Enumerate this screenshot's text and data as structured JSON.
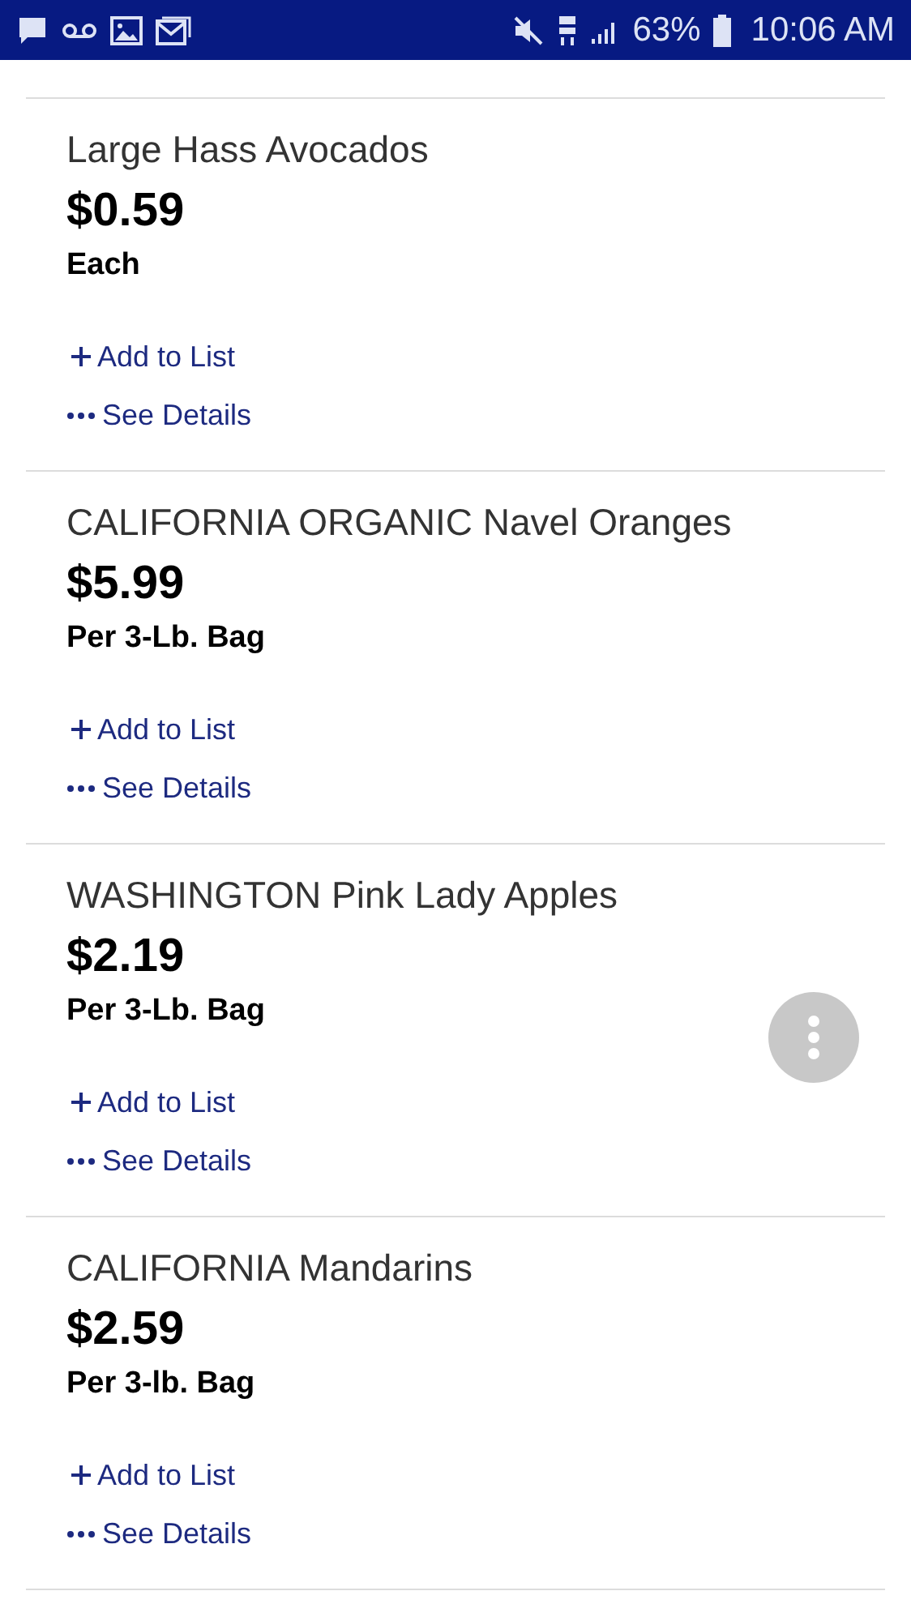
{
  "status_bar": {
    "battery": "63%",
    "time": "10:06 AM"
  },
  "products": [
    {
      "name": "Large Hass Avocados",
      "price": "$0.59",
      "unit": "Each",
      "add": "Add to List",
      "details": "See Details"
    },
    {
      "name": "CALIFORNIA ORGANIC Navel Oranges",
      "price": "$5.99",
      "unit": "Per 3-Lb. Bag",
      "add": "Add to List",
      "details": "See Details"
    },
    {
      "name": "WASHINGTON Pink Lady Apples",
      "price": "$2.19",
      "unit": "Per 3-Lb. Bag",
      "add": "Add to List",
      "details": "See Details"
    },
    {
      "name": "CALIFORNIA Mandarins",
      "price": "$2.59",
      "unit": "Per 3-lb. Bag",
      "add": "Add to List",
      "details": "See Details"
    }
  ]
}
